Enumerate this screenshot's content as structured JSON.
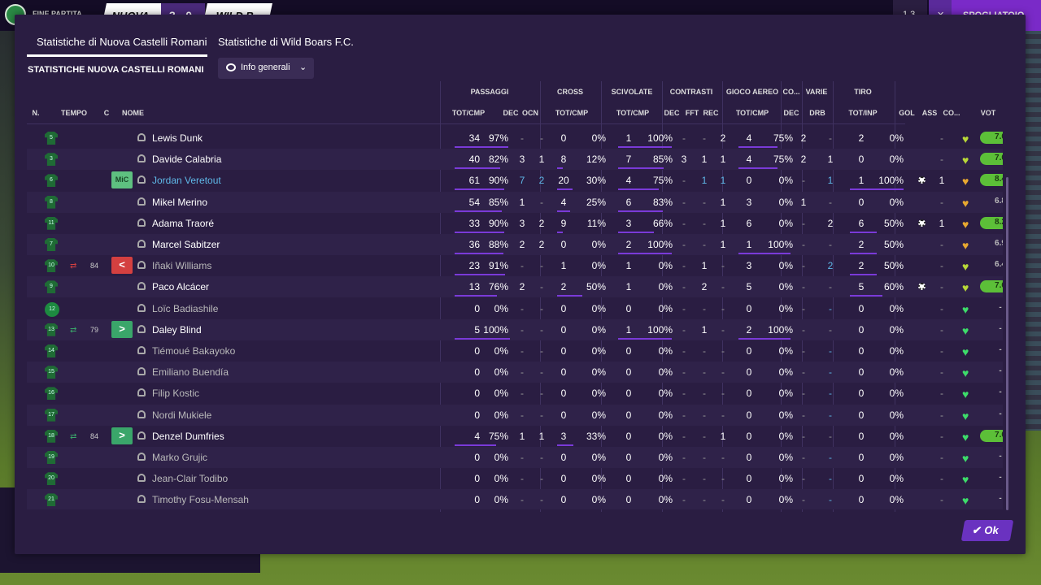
{
  "topbar": {
    "state": "FINE PARTITA",
    "home": "NUOVA",
    "score": "3 - 0",
    "away": "WILD B",
    "rbtn": "1 3",
    "rbtn2": "✕",
    "spogliatoio": "SPOGLIATOIO"
  },
  "tabs": [
    "Statistiche di Nuova Castelli Romani",
    "Statistiche di Wild Boars F.C."
  ],
  "section_title": "STATISTICHE NUOVA CASTELLI ROMANI",
  "dropdown": "Info generali",
  "groups": [
    "PASSAGGI",
    "CROSS",
    "SCIVOLATE",
    "CONTRASTI",
    "GIOCO AEREO",
    "CO...",
    "VARIE",
    "TIRO"
  ],
  "columns": [
    "N.",
    "TEMPO",
    "C",
    "NOME",
    "TOT/CMP",
    "DEC",
    "OCN",
    "TOT/CMP",
    "TOT/CMP",
    "DEC",
    "FFT",
    "REC",
    "TOT/CMP",
    "DEC",
    "DRB",
    "TOT/INP",
    "GOL",
    "ASS",
    "CO...",
    "VOT"
  ],
  "ok_label": "Ok",
  "colors": {
    "accent": "#7a3ad8",
    "rating_good": "#5cbf38",
    "heart_green": "#3ddc6a",
    "heart_gold": "#e8a830",
    "heart_lime": "#b8d838",
    "sub_out": "#d44040",
    "sub_in": "#3aa66a",
    "selected": "#5fb8e8"
  },
  "players": [
    {
      "n": "5",
      "tempo": "",
      "sub": "",
      "c": "",
      "name": "Lewis Dunk",
      "pass": "34",
      "passp": "97%",
      "pdec": "-",
      "pocn": "-",
      "cross": "0",
      "crossp": "0%",
      "sciv": "1",
      "scivp": "100%",
      "cdec": "-",
      "cfft": "-",
      "crec": "2",
      "air": "4",
      "airp": "75%",
      "codec": "2",
      "drb": "-",
      "shot": "2",
      "shotp": "0%",
      "gol": "",
      "ass": "-",
      "heart": "lime",
      "vot": "7.0",
      "votgood": true,
      "sel": false,
      "dim": false
    },
    {
      "n": "3",
      "tempo": "",
      "sub": "",
      "c": "",
      "name": "Davide Calabria",
      "pass": "40",
      "passp": "82%",
      "pdec": "3",
      "pocn": "1",
      "cross": "8",
      "crossp": "12%",
      "sciv": "7",
      "scivp": "85%",
      "cdec": "3",
      "cfft": "1",
      "crec": "1",
      "air": "4",
      "airp": "75%",
      "codec": "2",
      "drb": "1",
      "shot": "0",
      "shotp": "0%",
      "gol": "",
      "ass": "-",
      "heart": "lime",
      "vot": "7.0",
      "votgood": true,
      "sel": false,
      "dim": false
    },
    {
      "n": "6",
      "tempo": "",
      "sub": "",
      "c": "MiC",
      "name": "Jordan Veretout",
      "pass": "61",
      "passp": "90%",
      "pdec": "7",
      "pocn": "2",
      "cross": "20",
      "crossp": "30%",
      "sciv": "4",
      "scivp": "75%",
      "cdec": "-",
      "cfft": "1",
      "crec": "1",
      "air": "0",
      "airp": "0%",
      "codec": "-",
      "drb": "1",
      "shot": "1",
      "shotp": "100%",
      "gol": "ball",
      "ass": "1",
      "heart": "gold",
      "vot": "8.4",
      "votgood": true,
      "sel": true,
      "dim": false
    },
    {
      "n": "8",
      "tempo": "",
      "sub": "",
      "c": "",
      "name": "Mikel Merino",
      "pass": "54",
      "passp": "85%",
      "pdec": "1",
      "pocn": "-",
      "cross": "4",
      "crossp": "25%",
      "sciv": "6",
      "scivp": "83%",
      "cdec": "-",
      "cfft": "-",
      "crec": "1",
      "air": "3",
      "airp": "0%",
      "codec": "1",
      "drb": "-",
      "shot": "0",
      "shotp": "0%",
      "gol": "",
      "ass": "-",
      "heart": "gold",
      "vot": "6.8",
      "votgood": false,
      "sel": false,
      "dim": false
    },
    {
      "n": "11",
      "tempo": "",
      "sub": "",
      "c": "",
      "name": "Adama Traoré",
      "pass": "33",
      "passp": "90%",
      "pdec": "3",
      "pocn": "2",
      "cross": "9",
      "crossp": "11%",
      "sciv": "3",
      "scivp": "66%",
      "cdec": "-",
      "cfft": "-",
      "crec": "1",
      "air": "6",
      "airp": "0%",
      "codec": "-",
      "drb": "2",
      "shot": "6",
      "shotp": "50%",
      "gol": "ball",
      "ass": "1",
      "heart": "gold",
      "vot": "8.2",
      "votgood": true,
      "sel": false,
      "dim": false
    },
    {
      "n": "7",
      "tempo": "",
      "sub": "",
      "c": "",
      "name": "Marcel Sabitzer",
      "pass": "36",
      "passp": "88%",
      "pdec": "2",
      "pocn": "2",
      "cross": "0",
      "crossp": "0%",
      "sciv": "2",
      "scivp": "100%",
      "cdec": "-",
      "cfft": "-",
      "crec": "1",
      "air": "1",
      "airp": "100%",
      "codec": "-",
      "drb": "-",
      "shot": "2",
      "shotp": "50%",
      "gol": "",
      "ass": "-",
      "heart": "gold",
      "vot": "6.9",
      "votgood": false,
      "sel": false,
      "dim": false
    },
    {
      "n": "10",
      "tempo": "84",
      "sub": "out",
      "c": "<",
      "name": "Iñaki Williams",
      "pass": "23",
      "passp": "91%",
      "pdec": "-",
      "pocn": "-",
      "cross": "1",
      "crossp": "0%",
      "sciv": "1",
      "scivp": "0%",
      "cdec": "-",
      "cfft": "1",
      "crec": "-",
      "air": "3",
      "airp": "0%",
      "codec": "-",
      "drb": "2",
      "shot": "2",
      "shotp": "50%",
      "gol": "",
      "ass": "-",
      "heart": "lime",
      "vot": "6.4",
      "votgood": false,
      "sel": false,
      "dim": true
    },
    {
      "n": "9",
      "tempo": "",
      "sub": "",
      "c": "",
      "name": "Paco Alcácer",
      "pass": "13",
      "passp": "76%",
      "pdec": "2",
      "pocn": "-",
      "cross": "2",
      "crossp": "50%",
      "sciv": "1",
      "scivp": "0%",
      "cdec": "-",
      "cfft": "2",
      "crec": "-",
      "air": "5",
      "airp": "0%",
      "codec": "-",
      "drb": "-",
      "shot": "5",
      "shotp": "60%",
      "gol": "ball",
      "ass": "-",
      "heart": "lime",
      "vot": "7.6",
      "votgood": true,
      "sel": false,
      "dim": false
    },
    {
      "n": "12",
      "tempo": "",
      "sub": "",
      "c": "",
      "name": "Loïc Badiashile",
      "pass": "0",
      "passp": "0%",
      "pdec": "-",
      "pocn": "-",
      "cross": "0",
      "crossp": "0%",
      "sciv": "0",
      "scivp": "0%",
      "cdec": "-",
      "cfft": "-",
      "crec": "-",
      "air": "0",
      "airp": "0%",
      "codec": "-",
      "drb": "-",
      "shot": "0",
      "shotp": "0%",
      "gol": "",
      "ass": "-",
      "heart": "green",
      "vot": "-",
      "votgood": false,
      "sel": false,
      "dim": true,
      "gk": true
    },
    {
      "n": "13",
      "tempo": "79",
      "sub": "in",
      "c": ">",
      "name": "Daley Blind",
      "pass": "5",
      "passp": "100%",
      "pdec": "-",
      "pocn": "-",
      "cross": "0",
      "crossp": "0%",
      "sciv": "1",
      "scivp": "100%",
      "cdec": "-",
      "cfft": "1",
      "crec": "-",
      "air": "2",
      "airp": "100%",
      "codec": "-",
      "drb": "-",
      "shot": "0",
      "shotp": "0%",
      "gol": "",
      "ass": "-",
      "heart": "green",
      "vot": "-",
      "votgood": false,
      "sel": false,
      "dim": false
    },
    {
      "n": "14",
      "tempo": "",
      "sub": "",
      "c": "",
      "name": "Tiémoué Bakayoko",
      "pass": "0",
      "passp": "0%",
      "pdec": "-",
      "pocn": "-",
      "cross": "0",
      "crossp": "0%",
      "sciv": "0",
      "scivp": "0%",
      "cdec": "-",
      "cfft": "-",
      "crec": "-",
      "air": "0",
      "airp": "0%",
      "codec": "-",
      "drb": "-",
      "shot": "0",
      "shotp": "0%",
      "gol": "",
      "ass": "-",
      "heart": "green",
      "vot": "-",
      "votgood": false,
      "sel": false,
      "dim": true
    },
    {
      "n": "15",
      "tempo": "",
      "sub": "",
      "c": "",
      "name": "Emiliano Buendía",
      "pass": "0",
      "passp": "0%",
      "pdec": "-",
      "pocn": "-",
      "cross": "0",
      "crossp": "0%",
      "sciv": "0",
      "scivp": "0%",
      "cdec": "-",
      "cfft": "-",
      "crec": "-",
      "air": "0",
      "airp": "0%",
      "codec": "-",
      "drb": "-",
      "shot": "0",
      "shotp": "0%",
      "gol": "",
      "ass": "-",
      "heart": "green",
      "vot": "-",
      "votgood": false,
      "sel": false,
      "dim": true
    },
    {
      "n": "16",
      "tempo": "",
      "sub": "",
      "c": "",
      "name": "Filip Kostic",
      "pass": "0",
      "passp": "0%",
      "pdec": "-",
      "pocn": "-",
      "cross": "0",
      "crossp": "0%",
      "sciv": "0",
      "scivp": "0%",
      "cdec": "-",
      "cfft": "-",
      "crec": "-",
      "air": "0",
      "airp": "0%",
      "codec": "-",
      "drb": "-",
      "shot": "0",
      "shotp": "0%",
      "gol": "",
      "ass": "-",
      "heart": "green",
      "vot": "-",
      "votgood": false,
      "sel": false,
      "dim": true
    },
    {
      "n": "17",
      "tempo": "",
      "sub": "",
      "c": "",
      "name": "Nordi Mukiele",
      "pass": "0",
      "passp": "0%",
      "pdec": "-",
      "pocn": "-",
      "cross": "0",
      "crossp": "0%",
      "sciv": "0",
      "scivp": "0%",
      "cdec": "-",
      "cfft": "-",
      "crec": "-",
      "air": "0",
      "airp": "0%",
      "codec": "-",
      "drb": "-",
      "shot": "0",
      "shotp": "0%",
      "gol": "",
      "ass": "-",
      "heart": "green",
      "vot": "-",
      "votgood": false,
      "sel": false,
      "dim": true
    },
    {
      "n": "18",
      "tempo": "84",
      "sub": "in",
      "c": ">",
      "name": "Denzel Dumfries",
      "pass": "4",
      "passp": "75%",
      "pdec": "1",
      "pocn": "1",
      "cross": "3",
      "crossp": "33%",
      "sciv": "0",
      "scivp": "0%",
      "cdec": "-",
      "cfft": "-",
      "crec": "1",
      "air": "0",
      "airp": "0%",
      "codec": "-",
      "drb": "-",
      "shot": "0",
      "shotp": "0%",
      "gol": "",
      "ass": "-",
      "heart": "green",
      "vot": "7.0",
      "votgood": true,
      "sel": false,
      "dim": false
    },
    {
      "n": "19",
      "tempo": "",
      "sub": "",
      "c": "",
      "name": "Marko Grujic",
      "pass": "0",
      "passp": "0%",
      "pdec": "-",
      "pocn": "-",
      "cross": "0",
      "crossp": "0%",
      "sciv": "0",
      "scivp": "0%",
      "cdec": "-",
      "cfft": "-",
      "crec": "-",
      "air": "0",
      "airp": "0%",
      "codec": "-",
      "drb": "-",
      "shot": "0",
      "shotp": "0%",
      "gol": "",
      "ass": "-",
      "heart": "green",
      "vot": "-",
      "votgood": false,
      "sel": false,
      "dim": true
    },
    {
      "n": "20",
      "tempo": "",
      "sub": "",
      "c": "",
      "name": "Jean-Clair Todibo",
      "pass": "0",
      "passp": "0%",
      "pdec": "-",
      "pocn": "-",
      "cross": "0",
      "crossp": "0%",
      "sciv": "0",
      "scivp": "0%",
      "cdec": "-",
      "cfft": "-",
      "crec": "-",
      "air": "0",
      "airp": "0%",
      "codec": "-",
      "drb": "-",
      "shot": "0",
      "shotp": "0%",
      "gol": "",
      "ass": "-",
      "heart": "green",
      "vot": "-",
      "votgood": false,
      "sel": false,
      "dim": true
    },
    {
      "n": "21",
      "tempo": "",
      "sub": "",
      "c": "",
      "name": "Timothy Fosu-Mensah",
      "pass": "0",
      "passp": "0%",
      "pdec": "-",
      "pocn": "-",
      "cross": "0",
      "crossp": "0%",
      "sciv": "0",
      "scivp": "0%",
      "cdec": "-",
      "cfft": "-",
      "crec": "-",
      "air": "0",
      "airp": "0%",
      "codec": "-",
      "drb": "-",
      "shot": "0",
      "shotp": "0%",
      "gol": "",
      "ass": "-",
      "heart": "green",
      "vot": "-",
      "votgood": false,
      "sel": false,
      "dim": true
    }
  ]
}
